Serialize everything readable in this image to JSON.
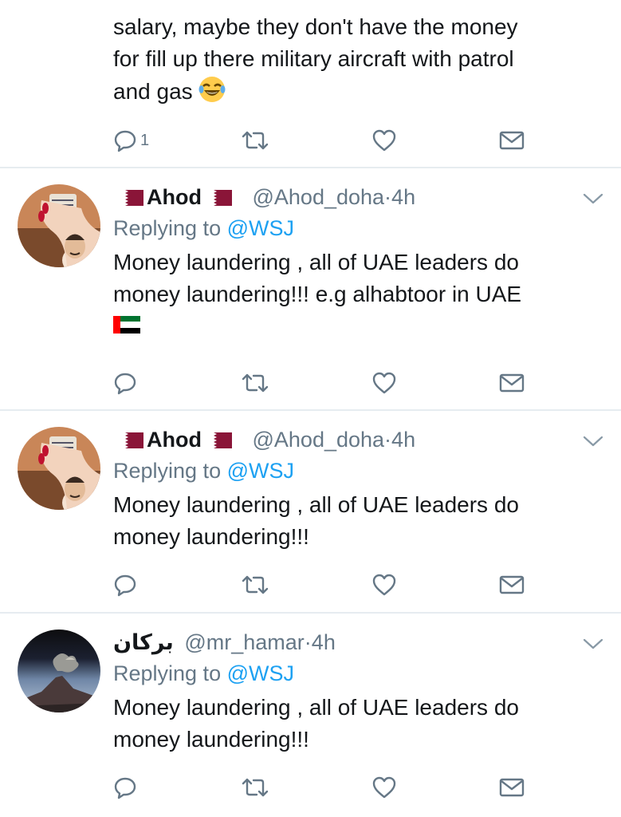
{
  "tweets": [
    {
      "body_lines": [
        "salary, maybe they don't have the money",
        "for fill up there military aircraft with patrol",
        "and gas"
      ],
      "emoji": "face-with-tears-of-joy",
      "reply_count": "1"
    },
    {
      "name": "Ahod",
      "handle": "@Ahod_doha",
      "dot": "·",
      "time": "4h",
      "replying_prefix": "Replying to",
      "replying_to": "@WSJ",
      "body_lines": [
        "Money laundering , all of UAE leaders do",
        "money laundering!!! e.g alhabtoor in UAE"
      ],
      "flag": "uae-flag"
    },
    {
      "name": "Ahod",
      "handle": "@Ahod_doha",
      "dot": "·",
      "time": "4h",
      "replying_prefix": "Replying to",
      "replying_to": "@WSJ",
      "body_lines": [
        "Money laundering , all of UAE leaders do",
        "money laundering!!!"
      ]
    },
    {
      "name": "بركان",
      "handle": "@mr_hamar",
      "dot": "·",
      "time": "4h",
      "replying_prefix": "Replying to",
      "replying_to": "@WSJ",
      "body_lines": [
        "Money laundering , all of UAE leaders do",
        "money laundering!!!"
      ]
    }
  ],
  "colors": {
    "primary_text": "#14171a",
    "secondary_text": "#657786",
    "link": "#1da1f2",
    "divider": "#e6ecf0",
    "qatar_maroon": "#8a1538"
  },
  "icons": [
    "reply-icon",
    "retweet-icon",
    "like-icon",
    "direct-message-icon",
    "chevron-down-icon"
  ]
}
